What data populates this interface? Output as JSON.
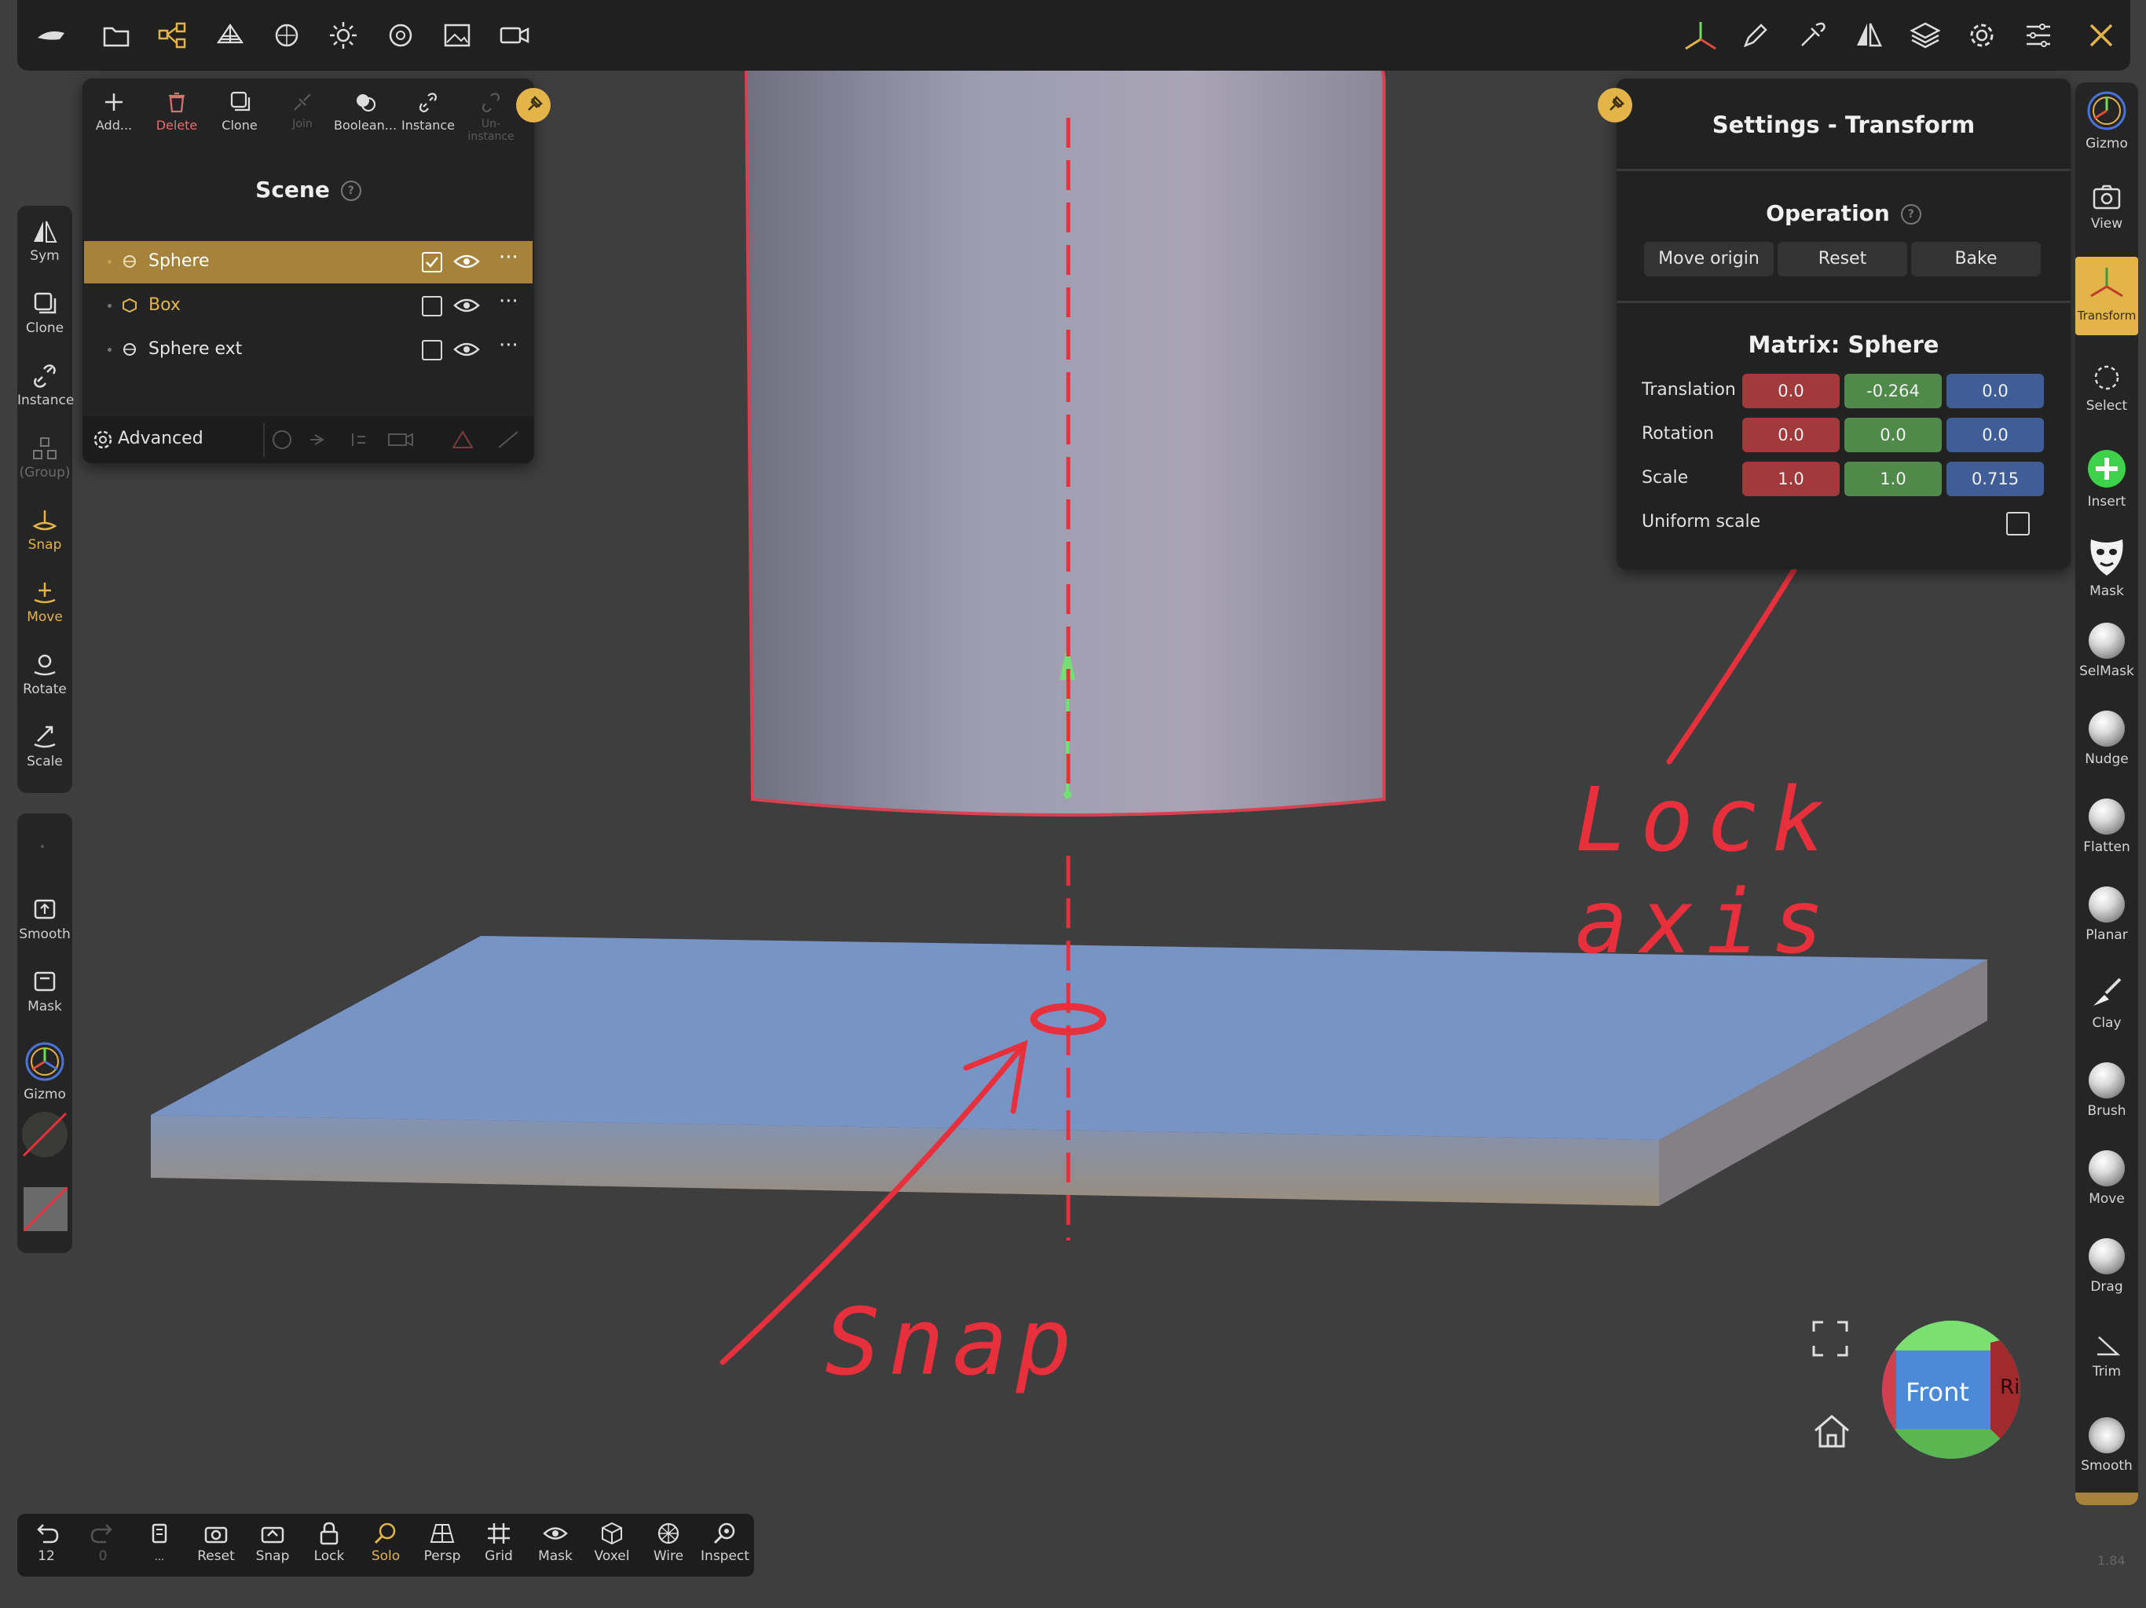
{
  "colors": {
    "accent": "#e2b44a",
    "delete": "#e07070",
    "selection": "#a6823a",
    "annotation": "#e8303c",
    "x_axis": "#a23a3c",
    "y_axis": "#4f8a4a",
    "z_axis": "#3f5e98"
  },
  "topbar": {
    "left_icons": [
      "menu-icon",
      "folder-icon",
      "scene-graph-icon",
      "topology-icon",
      "material-sphere-icon",
      "light-icon",
      "shading-icon",
      "image-icon",
      "camera-icon"
    ],
    "right_icons": [
      "gizmo-axes-icon",
      "brush-pen-icon",
      "eyedropper-icon",
      "symmetry-icon",
      "layers-icon",
      "gear-icon",
      "sliders-icon",
      "tools-icon"
    ]
  },
  "left_toolbar": {
    "items": [
      {
        "label": "Sym"
      },
      {
        "label": "Clone"
      },
      {
        "label": "Instance"
      },
      {
        "label": "(Group)"
      },
      {
        "label": "Snap"
      },
      {
        "label": "Move"
      },
      {
        "label": "Rotate"
      },
      {
        "label": "Scale"
      }
    ]
  },
  "left_toolbar2": {
    "items": [
      {
        "label": "Smooth"
      },
      {
        "label": "Mask"
      },
      {
        "label": "Gizmo"
      }
    ]
  },
  "scene": {
    "actions": [
      {
        "label": "Add..."
      },
      {
        "label": "Delete"
      },
      {
        "label": "Clone"
      },
      {
        "label": "Join"
      },
      {
        "label": "Boolean..."
      },
      {
        "label": "Instance"
      },
      {
        "label": "Un-instance"
      }
    ],
    "title": "Scene",
    "rows": [
      {
        "name": "Sphere",
        "checked": true,
        "selected": true
      },
      {
        "name": "Box",
        "checked": false,
        "selected": false
      },
      {
        "name": "Sphere ext",
        "checked": false,
        "selected": false
      }
    ],
    "footer_label": "Advanced"
  },
  "settings": {
    "title": "Settings - Transform",
    "operation": {
      "title": "Operation",
      "buttons": [
        "Move origin",
        "Reset",
        "Bake"
      ]
    },
    "matrix": {
      "title": "Matrix:",
      "object": "Sphere",
      "rows": [
        {
          "label": "Translation",
          "x": "0.0",
          "y": "-0.264",
          "z": "0.0"
        },
        {
          "label": "Rotation",
          "x": "0.0",
          "y": "0.0",
          "z": "0.0"
        },
        {
          "label": "Scale",
          "x": "1.0",
          "y": "1.0",
          "z": "0.715"
        }
      ],
      "uniform_label": "Uniform scale",
      "uniform_checked": false
    }
  },
  "right_toolbar": {
    "items": [
      {
        "label": "Gizmo"
      },
      {
        "label": "View"
      },
      {
        "label": "Transform"
      },
      {
        "label": "Select"
      },
      {
        "label": "Insert"
      },
      {
        "label": "Mask"
      },
      {
        "label": "SelMask"
      },
      {
        "label": "Nudge"
      },
      {
        "label": "Flatten"
      },
      {
        "label": "Planar"
      },
      {
        "label": "Clay"
      },
      {
        "label": "Brush"
      },
      {
        "label": "Move"
      },
      {
        "label": "Drag"
      },
      {
        "label": "Trim"
      },
      {
        "label": "Smooth"
      }
    ]
  },
  "bottom": {
    "items": [
      {
        "label": "12"
      },
      {
        "label": "0"
      },
      {
        "label": "..."
      },
      {
        "label": "Reset"
      },
      {
        "label": "Snap"
      },
      {
        "label": "Lock"
      },
      {
        "label": "Solo"
      },
      {
        "label": "Persp"
      },
      {
        "label": "Grid"
      },
      {
        "label": "Mask"
      },
      {
        "label": "Voxel"
      },
      {
        "label": "Wire"
      },
      {
        "label": "Inspect"
      }
    ]
  },
  "view_cube": {
    "face": "Front",
    "side": "Ri"
  },
  "annotations": {
    "snap": "Snap",
    "lock": "Lock axis"
  },
  "version": "1.84"
}
